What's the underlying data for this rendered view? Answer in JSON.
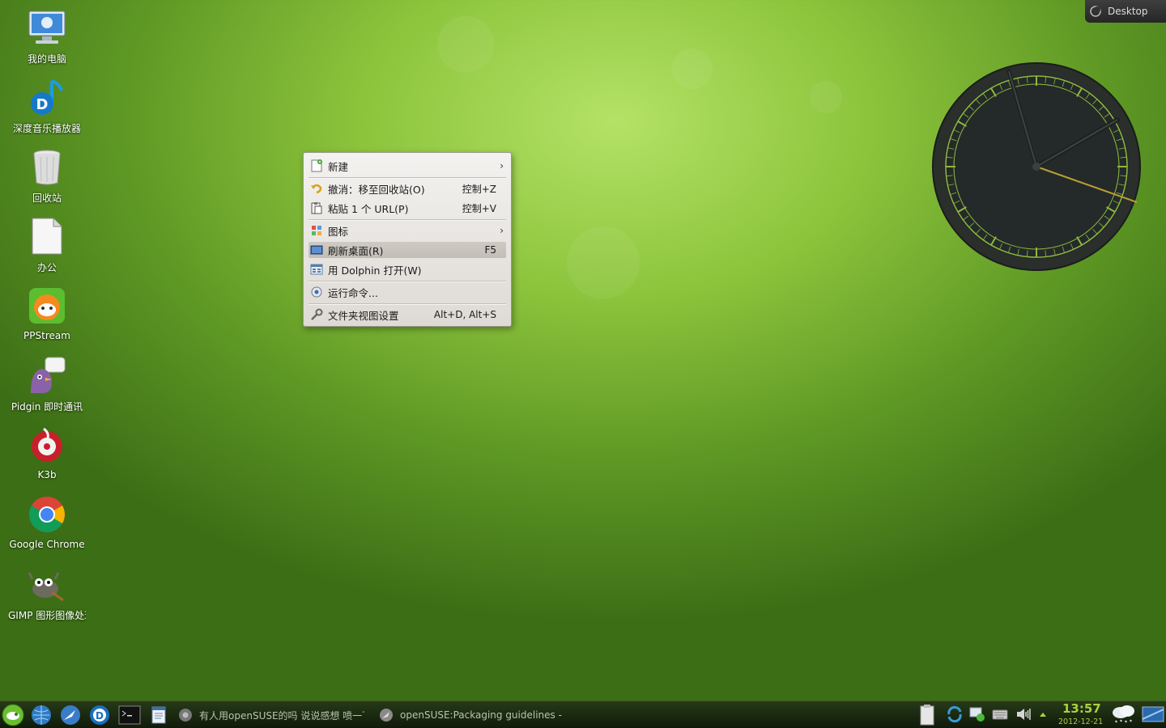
{
  "toolbox": {
    "label": "Desktop"
  },
  "desktop_icons": [
    {
      "label": "我的电脑",
      "icon": "computer-icon"
    },
    {
      "label": "深度音乐播放器",
      "icon": "deepin-music-icon"
    },
    {
      "label": "回收站",
      "icon": "trash-icon"
    },
    {
      "label": "办公",
      "icon": "document-icon"
    },
    {
      "label": "PPStream",
      "icon": "ppstream-icon"
    },
    {
      "label": "Pidgin 即时通讯",
      "icon": "pidgin-icon"
    },
    {
      "label": "K3b",
      "icon": "k3b-icon"
    },
    {
      "label": "Google Chrome",
      "icon": "chrome-icon"
    },
    {
      "label": "GIMP 图形图像处理",
      "icon": "gimp-icon"
    }
  ],
  "context_menu": {
    "items": [
      {
        "label": "新建",
        "shortcut": "",
        "submenu": "›",
        "icon": "new-icon"
      },
      {
        "label": "撤消：移至回收站(O)",
        "shortcut": "控制+Z",
        "icon": "undo-icon"
      },
      {
        "label": "粘贴 1 个 URL(P)",
        "shortcut": "控制+V",
        "icon": "paste-icon"
      },
      {
        "label": "图标",
        "shortcut": "",
        "submenu": "›",
        "icon": "icons-icon"
      },
      {
        "label": "刷新桌面(R)",
        "shortcut": "F5",
        "icon": "refresh-desktop-icon",
        "highlighted": true
      },
      {
        "label": "用 Dolphin 打开(W)",
        "shortcut": "",
        "icon": "dolphin-icon"
      },
      {
        "label": "运行命令...",
        "shortcut": "",
        "icon": "run-command-icon"
      },
      {
        "label": "文件夹视图设置",
        "shortcut": "Alt+D, Alt+S",
        "icon": "settings-icon"
      }
    ]
  },
  "taskbar": {
    "launchers": [
      "opensuse-menu-icon",
      "network-globe-icon",
      "browser-icon",
      "deepin-music-icon",
      "terminal-icon",
      "text-editor-icon"
    ],
    "tasks": [
      {
        "label": "有人用openSUSE的吗 说说感想 喷一下",
        "icon": "chrome-icon"
      },
      {
        "label": "openSUSE:Packaging guidelines - openSUSE",
        "icon": "browser-window-icon"
      }
    ],
    "tray": [
      "clipboard-icon",
      "update-icon",
      "network-icon",
      "keyboard-icon",
      "volume-icon",
      "expand-tray-icon"
    ],
    "clock": {
      "time": "13:57",
      "date": "2012-12-21"
    },
    "weather_icon": "weather-snow-icon",
    "show_desktop_icon": "show-desktop-icon"
  },
  "colors": {
    "accent": "#a9d23e",
    "menu_bg": "#ebe8e4",
    "taskbar_bg": "#1a2a10"
  }
}
